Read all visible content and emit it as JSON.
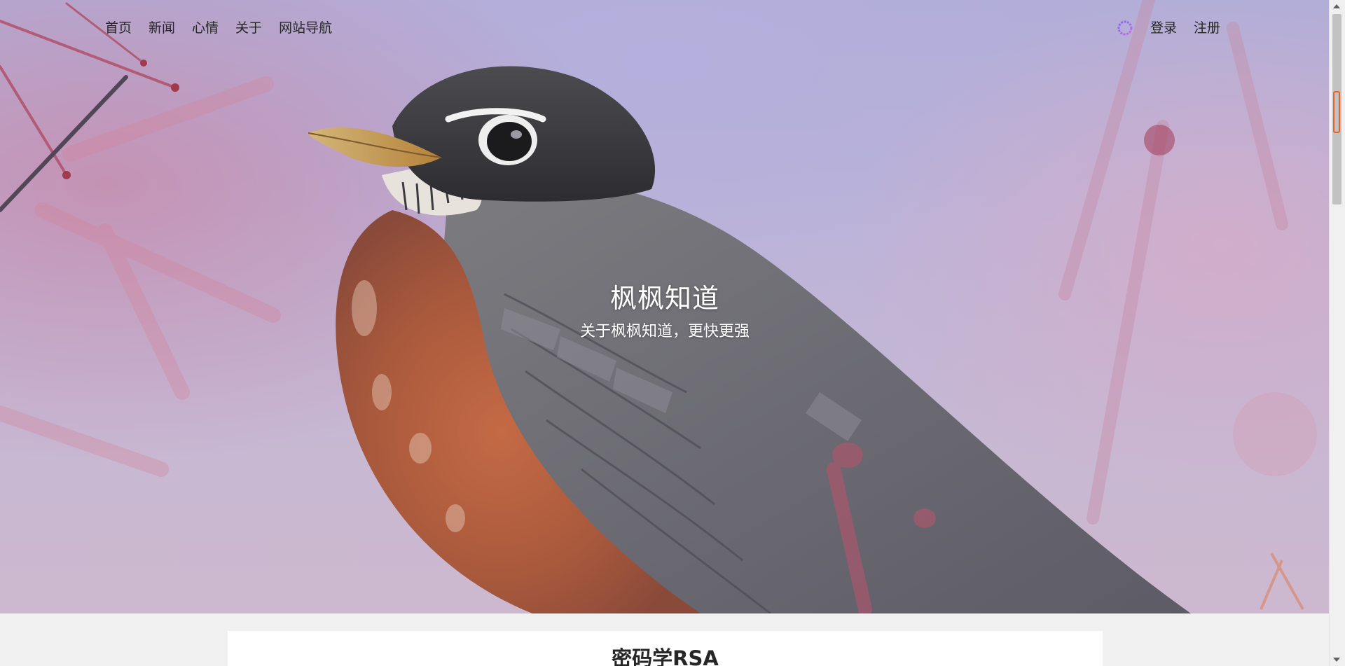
{
  "nav": {
    "left_items": [
      {
        "label": "首页"
      },
      {
        "label": "新闻"
      },
      {
        "label": "心情"
      },
      {
        "label": "关于"
      },
      {
        "label": "网站导航"
      }
    ],
    "theme_icon": "spinner-icon",
    "login_label": "登录",
    "register_label": "注册"
  },
  "hero": {
    "title": "枫枫知道",
    "subtitle": "关于枫枫知道，更快更强",
    "image": "robin-bird-photo"
  },
  "article": {
    "title": "密码学RSA"
  },
  "colors": {
    "nav_text": "#262626",
    "hero_text": "#ffffff",
    "page_background": "#f0f0f0",
    "card_background": "#ffffff"
  }
}
